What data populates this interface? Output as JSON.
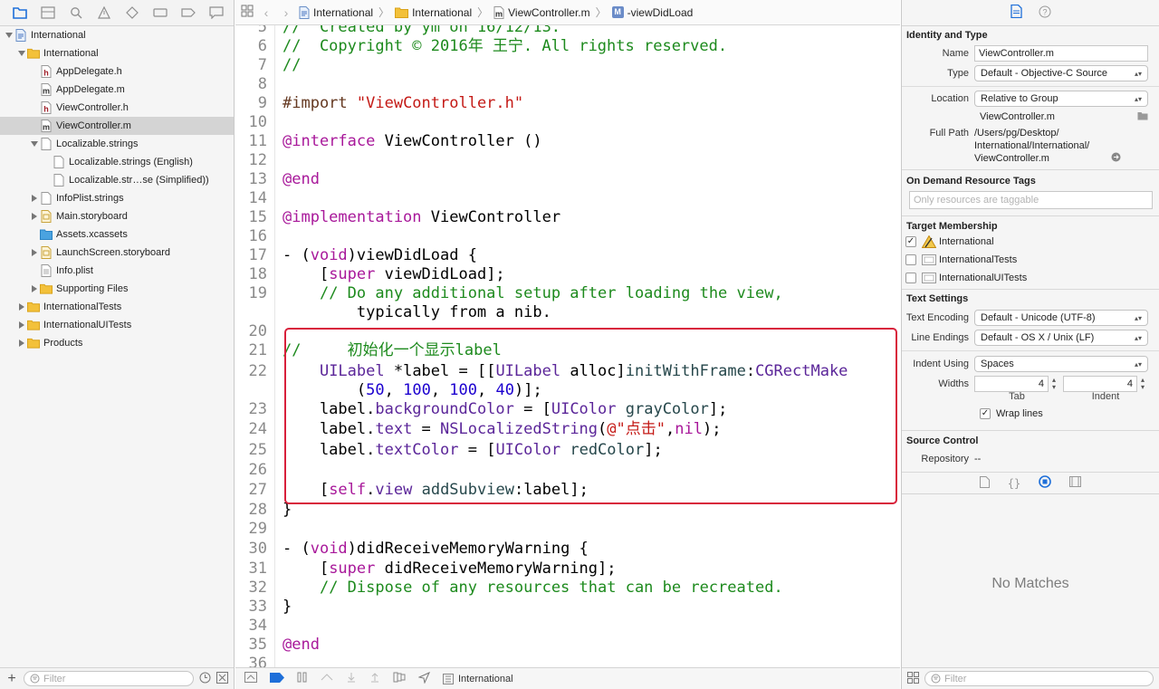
{
  "navigator": {
    "items": [
      {
        "label": "International",
        "level": 0,
        "kind": "project",
        "disclosure": "open",
        "selected": false
      },
      {
        "label": "International",
        "level": 1,
        "kind": "folder",
        "disclosure": "open",
        "selected": false
      },
      {
        "label": "AppDelegate.h",
        "level": 2,
        "kind": "h",
        "disclosure": "none",
        "selected": false
      },
      {
        "label": "AppDelegate.m",
        "level": 2,
        "kind": "m",
        "disclosure": "none",
        "selected": false
      },
      {
        "label": "ViewController.h",
        "level": 2,
        "kind": "h",
        "disclosure": "none",
        "selected": false
      },
      {
        "label": "ViewController.m",
        "level": 2,
        "kind": "m",
        "disclosure": "none",
        "selected": true
      },
      {
        "label": "Localizable.strings",
        "level": 2,
        "kind": "strings",
        "disclosure": "open",
        "selected": false
      },
      {
        "label": "Localizable.strings (English)",
        "level": 3,
        "kind": "strings",
        "disclosure": "none",
        "selected": false
      },
      {
        "label": "Localizable.str…se (Simplified))",
        "level": 3,
        "kind": "strings",
        "disclosure": "none",
        "selected": false
      },
      {
        "label": "InfoPlist.strings",
        "level": 2,
        "kind": "strings",
        "disclosure": "closed",
        "selected": false
      },
      {
        "label": "Main.storyboard",
        "level": 2,
        "kind": "storyboard",
        "disclosure": "closed",
        "selected": false
      },
      {
        "label": "Assets.xcassets",
        "level": 2,
        "kind": "assets",
        "disclosure": "none",
        "selected": false
      },
      {
        "label": "LaunchScreen.storyboard",
        "level": 2,
        "kind": "storyboard",
        "disclosure": "closed",
        "selected": false
      },
      {
        "label": "Info.plist",
        "level": 2,
        "kind": "plist",
        "disclosure": "none",
        "selected": false
      },
      {
        "label": "Supporting Files",
        "level": 2,
        "kind": "folder",
        "disclosure": "closed",
        "selected": false
      },
      {
        "label": "InternationalTests",
        "level": 1,
        "kind": "folder",
        "disclosure": "closed",
        "selected": false
      },
      {
        "label": "InternationalUITests",
        "level": 1,
        "kind": "folder",
        "disclosure": "closed",
        "selected": false
      },
      {
        "label": "Products",
        "level": 1,
        "kind": "folder",
        "disclosure": "closed",
        "selected": false
      }
    ],
    "filter_placeholder": "Filter"
  },
  "jumpbar": {
    "crumbs": [
      "International",
      "International",
      "ViewController.m",
      "-viewDidLoad"
    ],
    "method_badge": "M"
  },
  "editor": {
    "lines": [
      {
        "n": "5",
        "text": "//  Created by ym on 16/12/13."
      },
      {
        "n": "6",
        "text": "//  Copyright © 2016年 王宁. All rights reserved."
      },
      {
        "n": "7",
        "text": "//"
      },
      {
        "n": "8",
        "text": ""
      },
      {
        "n": "9",
        "text": "#import \"ViewController.h\""
      },
      {
        "n": "10",
        "text": ""
      },
      {
        "n": "11",
        "text": "@interface ViewController ()"
      },
      {
        "n": "12",
        "text": ""
      },
      {
        "n": "13",
        "text": "@end"
      },
      {
        "n": "14",
        "text": ""
      },
      {
        "n": "15",
        "text": "@implementation ViewController"
      },
      {
        "n": "16",
        "text": ""
      },
      {
        "n": "17",
        "text": "- (void)viewDidLoad {"
      },
      {
        "n": "18",
        "text": "    [super viewDidLoad];"
      },
      {
        "n": "19",
        "text": "    // Do any additional setup after loading the view,"
      },
      {
        "n": "",
        "text": "        typically from a nib."
      },
      {
        "n": "20",
        "text": ""
      },
      {
        "n": "21",
        "text": "//     初始化一个显示label"
      },
      {
        "n": "22",
        "text": "    UILabel *label = [[UILabel alloc]initWithFrame:CGRectMake"
      },
      {
        "n": "",
        "text": "        (50, 100, 100, 40)];"
      },
      {
        "n": "23",
        "text": "    label.backgroundColor = [UIColor grayColor];"
      },
      {
        "n": "24",
        "text": "    label.text = NSLocalizedString(@\"点击\",nil);"
      },
      {
        "n": "25",
        "text": "    label.textColor = [UIColor redColor];"
      },
      {
        "n": "26",
        "text": ""
      },
      {
        "n": "27",
        "text": "    [self.view addSubview:label];"
      },
      {
        "n": "28",
        "text": "}"
      },
      {
        "n": "29",
        "text": ""
      },
      {
        "n": "30",
        "text": "- (void)didReceiveMemoryWarning {"
      },
      {
        "n": "31",
        "text": "    [super didReceiveMemoryWarning];"
      },
      {
        "n": "32",
        "text": "    // Dispose of any resources that can be recreated."
      },
      {
        "n": "33",
        "text": "}"
      },
      {
        "n": "34",
        "text": ""
      },
      {
        "n": "35",
        "text": "@end"
      },
      {
        "n": "36",
        "text": ""
      }
    ],
    "highlight_color": "#d8203b"
  },
  "debugbar": {
    "target": "International"
  },
  "inspector": {
    "identity": {
      "header": "Identity and Type",
      "name_label": "Name",
      "name_value": "ViewController.m",
      "type_label": "Type",
      "type_value": "Default - Objective-C Source",
      "location_label": "Location",
      "location_value": "Relative to Group",
      "location_file": "ViewController.m",
      "fullpath_label": "Full Path",
      "fullpath_lines": [
        "/Users/pg/Desktop/",
        "International/International/",
        "ViewController.m"
      ]
    },
    "tags": {
      "header": "On Demand Resource Tags",
      "placeholder": "Only resources are taggable"
    },
    "membership": {
      "header": "Target Membership",
      "targets": [
        {
          "label": "International",
          "checked": true
        },
        {
          "label": "InternationalTests",
          "checked": false
        },
        {
          "label": "InternationalUITests",
          "checked": false
        }
      ]
    },
    "text_settings": {
      "header": "Text Settings",
      "encoding_label": "Text Encoding",
      "encoding_value": "Default - Unicode (UTF-8)",
      "endings_label": "Line Endings",
      "endings_value": "Default - OS X / Unix (LF)",
      "indent_label": "Indent Using",
      "indent_value": "Spaces",
      "widths_label": "Widths",
      "tab_value": "4",
      "indent_width_value": "4",
      "tab_caption": "Tab",
      "indent_caption": "Indent",
      "wrap_label": "Wrap lines"
    },
    "source_control": {
      "header": "Source Control",
      "repo_label": "Repository",
      "repo_value": "--"
    },
    "library": {
      "empty_text": "No Matches",
      "filter_placeholder": "Filter"
    }
  },
  "colors": {
    "accent": "#1e6fd9",
    "selection": "#d4d4d4",
    "comment": "#1d8a1d",
    "keyword": "#a8189a",
    "string": "#c41a16"
  }
}
